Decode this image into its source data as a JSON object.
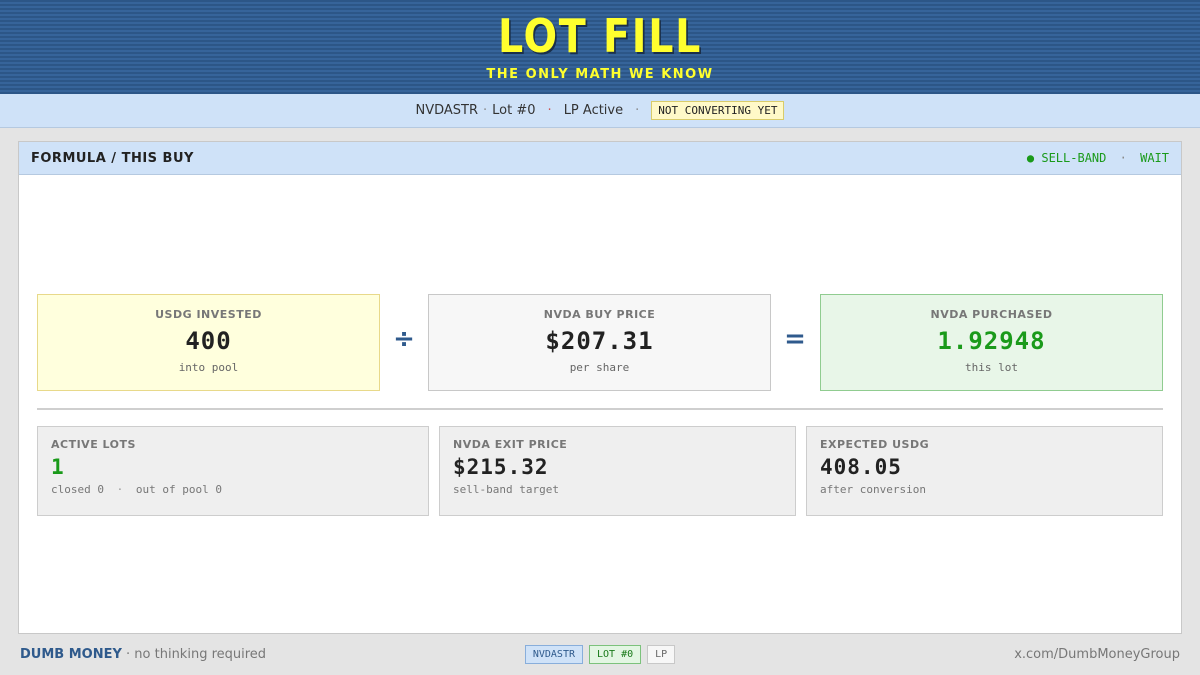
{
  "banner": {
    "title": "LOT FILL",
    "subtitle": "THE ONLY MATH WE KNOW"
  },
  "status": {
    "ticker": "NVDASTR",
    "lot": "Lot #0",
    "lp": "LP Active",
    "convert_badge": "NOT CONVERTING YET",
    "separator": "·"
  },
  "panel": {
    "title": "FORMULA / THIS BUY",
    "state_primary": "● SELL-BAND",
    "state_secondary": "WAIT"
  },
  "formula": {
    "invested": {
      "label": "USDG INVESTED",
      "value": "400",
      "sub": "into pool"
    },
    "divide_op": "÷",
    "price": {
      "label": "NVDA BUY PRICE",
      "value": "$207.31",
      "sub": "per share"
    },
    "equals_op": "=",
    "purchased": {
      "label": "NVDA PURCHASED",
      "value": "1.92948",
      "sub": "this lot"
    }
  },
  "stats": {
    "active_lots": {
      "label": "ACTIVE LOTS",
      "value": "1",
      "sub_closed": "closed 0",
      "sub_out": "out of pool 0"
    },
    "exit_price": {
      "label": "NVDA EXIT PRICE",
      "value": "$215.32",
      "sub": "sell-band target"
    },
    "expected": {
      "label": "EXPECTED USDG",
      "value": "408.05",
      "sub": "after conversion"
    }
  },
  "footer": {
    "brand": "DUMB MONEY",
    "tagline": "· no thinking required",
    "tags": [
      "NVDASTR",
      "LOT #0",
      "LP"
    ],
    "link": "x.com/DumbMoneyGroup"
  },
  "colors": {
    "accent_blue": "#2f5a8c",
    "banner_yellow": "#ffff2e",
    "success_green": "#1a9a1a"
  }
}
